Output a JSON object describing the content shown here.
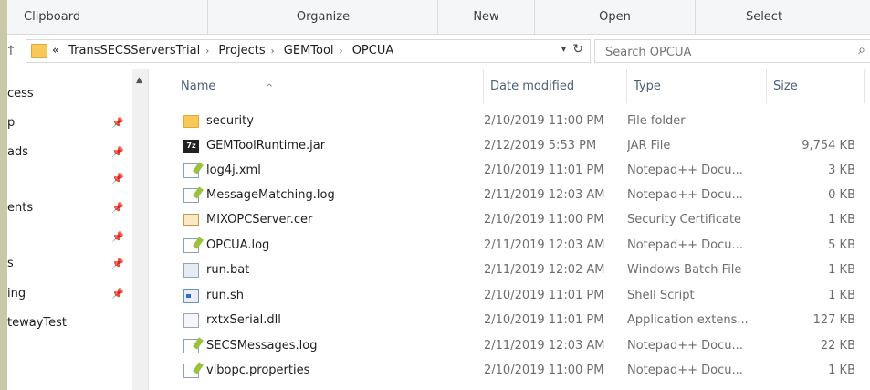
{
  "ribbon": {
    "groups": [
      "Clipboard",
      "Organize",
      "New",
      "Open",
      "Select"
    ]
  },
  "address": {
    "overflow": "«",
    "crumbs": [
      "TransSECSServersTrial",
      "Projects",
      "GEMTool",
      "OPCUA"
    ]
  },
  "search": {
    "placeholder": "Search OPCUA"
  },
  "nav": {
    "items": [
      {
        "label": "cess",
        "pinned": false
      },
      {
        "label": "p",
        "pinned": true
      },
      {
        "label": "ads",
        "pinned": true
      },
      {
        "label": "",
        "pinned": true
      },
      {
        "label": "ents",
        "pinned": true
      },
      {
        "label": "",
        "pinned": true
      },
      {
        "label": "s",
        "pinned": true
      },
      {
        "label": "ing",
        "pinned": true
      },
      {
        "label": "tewayTest",
        "pinned": false
      }
    ]
  },
  "columns": {
    "name": "Name",
    "date": "Date modified",
    "type": "Type",
    "size": "Size"
  },
  "files": [
    {
      "name": "security",
      "date": "2/10/2019 11:00 PM",
      "type": "File folder",
      "size": "",
      "icon": "folder-icon"
    },
    {
      "name": "GEMToolRuntime.jar",
      "date": "2/12/2019 5:53 PM",
      "type": "JAR File",
      "size": "9,754 KB",
      "icon": "jar-icon"
    },
    {
      "name": "log4j.xml",
      "date": "2/10/2019 11:01 PM",
      "type": "Notepad++ Docu...",
      "size": "3 KB",
      "icon": "notepad-icon"
    },
    {
      "name": "MessageMatching.log",
      "date": "2/11/2019 12:03 AM",
      "type": "Notepad++ Docu...",
      "size": "0 KB",
      "icon": "notepad-icon"
    },
    {
      "name": "MIXOPCServer.cer",
      "date": "2/10/2019 11:00 PM",
      "type": "Security Certificate",
      "size": "1 KB",
      "icon": "certificate-icon"
    },
    {
      "name": "OPCUA.log",
      "date": "2/11/2019 12:03 AM",
      "type": "Notepad++ Docu...",
      "size": "5 KB",
      "icon": "notepad-icon"
    },
    {
      "name": "run.bat",
      "date": "2/11/2019 12:02 AM",
      "type": "Windows Batch File",
      "size": "1 KB",
      "icon": "batch-file-icon"
    },
    {
      "name": "run.sh",
      "date": "2/10/2019 11:01 PM",
      "type": "Shell Script",
      "size": "1 KB",
      "icon": "shell-script-icon"
    },
    {
      "name": "rxtxSerial.dll",
      "date": "2/10/2019 11:01 PM",
      "type": "Application extens...",
      "size": "127 KB",
      "icon": "dll-icon"
    },
    {
      "name": "SECSMessages.log",
      "date": "2/11/2019 12:03 AM",
      "type": "Notepad++ Docu...",
      "size": "22 KB",
      "icon": "notepad-icon"
    },
    {
      "name": "vibopc.properties",
      "date": "2/10/2019 11:00 PM",
      "type": "Notepad++ Docu...",
      "size": "1 KB",
      "icon": "notepad-icon"
    }
  ]
}
